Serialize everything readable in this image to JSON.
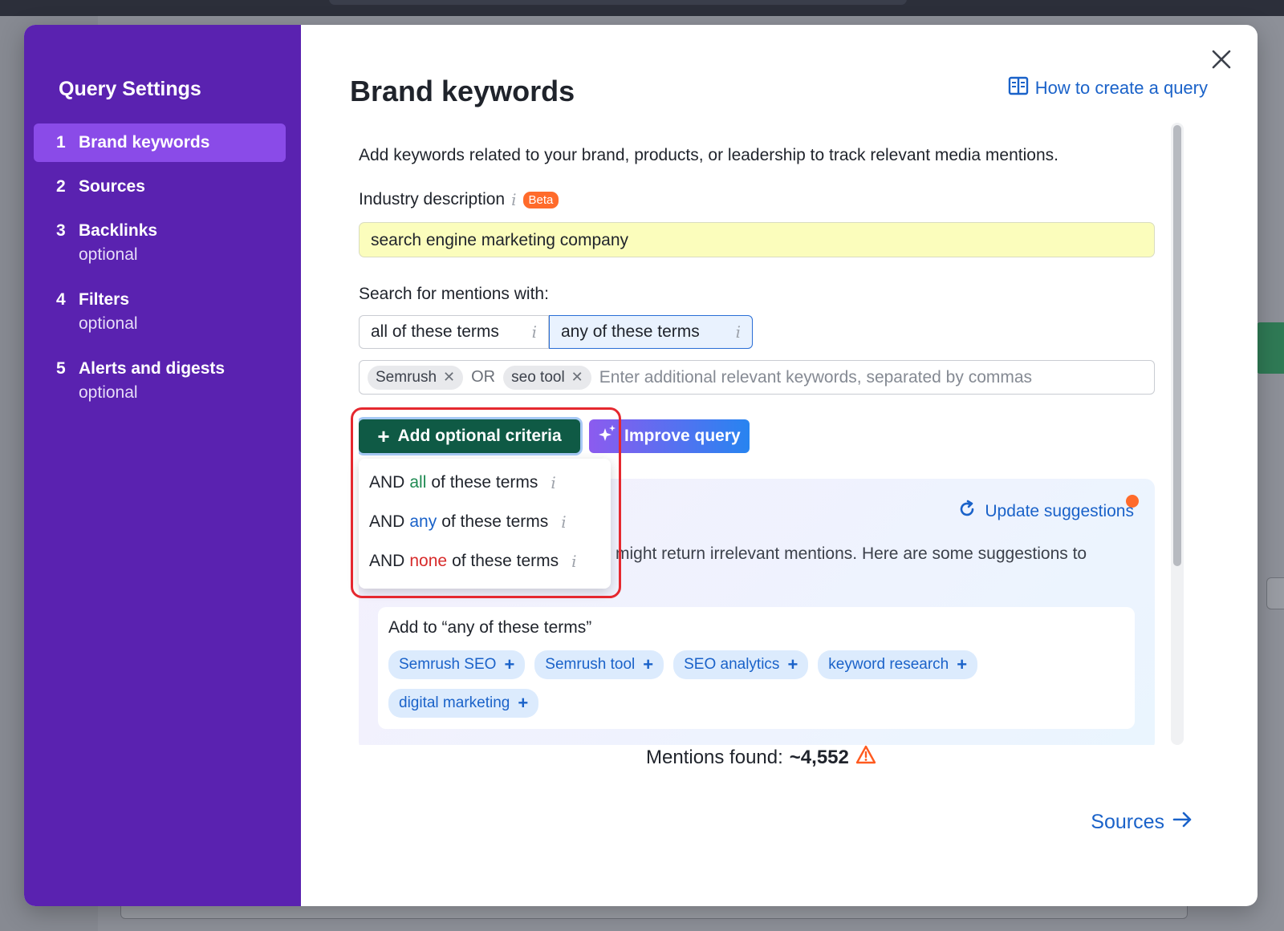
{
  "sidebar": {
    "title": "Query Settings",
    "steps": [
      {
        "num": "1",
        "label": "Brand keywords",
        "optional": ""
      },
      {
        "num": "2",
        "label": "Sources",
        "optional": ""
      },
      {
        "num": "3",
        "label": "Backlinks",
        "optional": "optional"
      },
      {
        "num": "4",
        "label": "Filters",
        "optional": "optional"
      },
      {
        "num": "5",
        "label": "Alerts and digests",
        "optional": "optional"
      }
    ]
  },
  "header": {
    "title": "Brand keywords",
    "help_link": "How to create a query"
  },
  "form": {
    "intro": "Add keywords related to your brand, products, or leadership to track relevant media mentions.",
    "industry_label": "Industry description",
    "beta_badge": "Beta",
    "industry_value": "search engine marketing company",
    "search_label": "Search for mentions with:",
    "mode_all": "all of these terms",
    "mode_any": "any of these terms",
    "keywords": [
      "Semrush",
      "seo tool"
    ],
    "or_label": "OR",
    "keywords_placeholder": "Enter additional relevant keywords, separated by commas",
    "add_criteria_label": "Add optional criteria",
    "improve_label": "Improve query"
  },
  "dropdown": {
    "items": [
      {
        "prefix": "AND",
        "keyword": "all",
        "suffix": "of these terms"
      },
      {
        "prefix": "AND",
        "keyword": "any",
        "suffix": "of these terms"
      },
      {
        "prefix": "AND",
        "keyword": "none",
        "suffix": "of these terms"
      }
    ]
  },
  "suggestions": {
    "update_label": "Update suggestions",
    "text_line1": "might return irrelevant mentions. Here are some suggestions to",
    "text_line2": "",
    "add_to_title": "Add to “any of these terms”",
    "chips": [
      "Semrush SEO",
      "Semrush tool",
      "SEO analytics",
      "keyword research",
      "digital marketing"
    ]
  },
  "footer": {
    "mentions_label": "Mentions found:",
    "mentions_value": "~4,552",
    "next_label": "Sources"
  },
  "colors": {
    "sidebar": "#5a22b0",
    "active_step": "#8a4be8",
    "primary_button": "#0f5a45",
    "link": "#1a62c9",
    "highlight": "#e5282f"
  }
}
